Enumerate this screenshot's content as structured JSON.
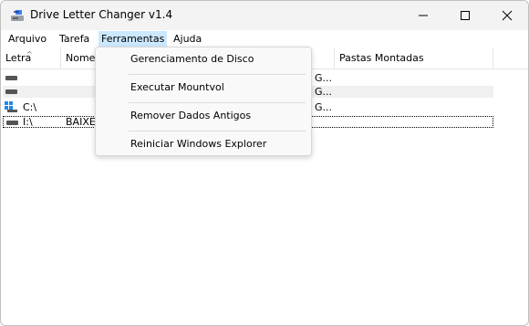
{
  "window": {
    "title": "Drive Letter Changer v1.4"
  },
  "menubar": {
    "items": [
      "Arquivo",
      "Tarefa",
      "Ferramentas",
      "Ajuda"
    ]
  },
  "listview": {
    "columns": [
      "Letra",
      "Nome",
      "Pastas Montadas"
    ],
    "rows": [
      {
        "letter": "",
        "name": "",
        "tail": "G..."
      },
      {
        "letter": "",
        "name": "",
        "tail": "G..."
      },
      {
        "letter": "C:\\",
        "name": "",
        "tail": "G..."
      },
      {
        "letter": "I:\\",
        "name": "BAIXES",
        "tail": ""
      }
    ]
  },
  "dropdown": {
    "items": [
      "Gerenciamento de Disco",
      "Executar Mountvol",
      "Remover Dados Antigos",
      "Reiniciar Windows Explorer"
    ]
  },
  "colors": {
    "menu_highlight": "#cce8ff",
    "titlebar_bg": "#f3f3f3"
  }
}
